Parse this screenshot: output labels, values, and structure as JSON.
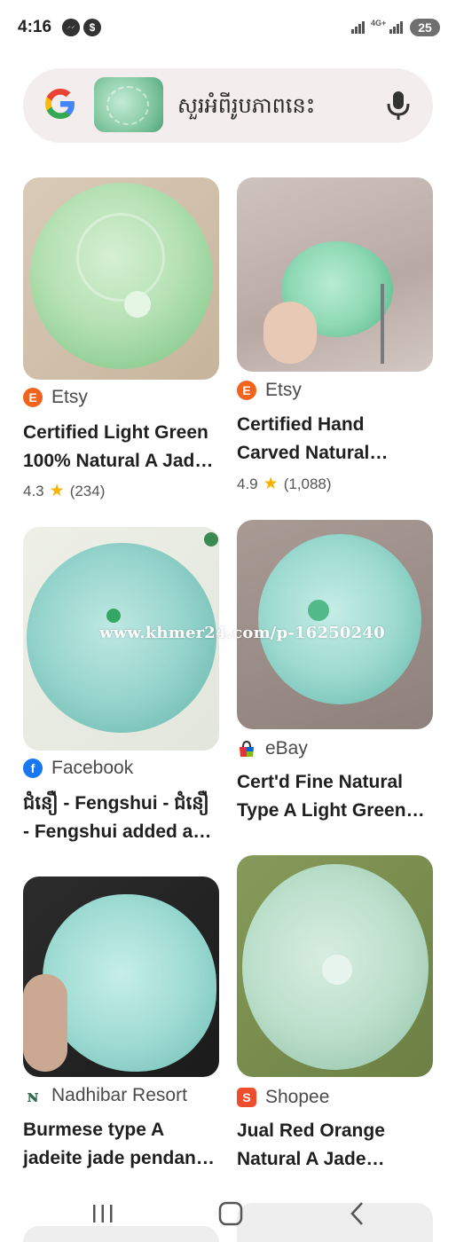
{
  "status": {
    "time": "4:16",
    "notif_badge": "$",
    "network": "4G+",
    "battery": "25"
  },
  "search": {
    "text": "សួរអំពីរូបភាពនេះ",
    "icon_google": "google-logo",
    "icon_mic": "mic-icon"
  },
  "results": [
    {
      "source": "Etsy",
      "source_icon": "E",
      "source_color": "#f1641e",
      "title_line1": "Certified Light Green",
      "title_line2": "100% Natural A Jad…",
      "rating_value": "4.3",
      "rating_count": "(234)"
    },
    {
      "source": "Etsy",
      "source_icon": "E",
      "source_color": "#f1641e",
      "title_line1": "Certified Hand",
      "title_line2": "Carved Natural…",
      "rating_value": "4.9",
      "rating_count": "(1,088)"
    },
    {
      "source": "Facebook",
      "source_icon": "f",
      "source_color": "#1877f2",
      "title_line1": "ជំនឿ - Fengshui - ជំនឿ",
      "title_line2": "- Fengshui added a…"
    },
    {
      "source": "eBay",
      "source_icon": "ebay-icon",
      "source_color": "#333333",
      "title_line1": "Cert'd Fine Natural",
      "title_line2": "Type A Light Green…"
    },
    {
      "source": "Nadhibar Resort",
      "source_icon": "ɴ",
      "source_color": "#2f6b4f",
      "title_line1": "Burmese type A",
      "title_line2": "jadeite jade pendan…"
    },
    {
      "source": "Shopee",
      "source_icon": "S",
      "source_color": "#ee4d2d",
      "title_line1": "Jual Red Orange",
      "title_line2": "Natural A Jade…"
    }
  ],
  "watermark": "www.khmer24.com/p-16250240",
  "nav": {
    "recent": "recent-apps-icon",
    "home": "home-icon",
    "back": "back-icon"
  }
}
